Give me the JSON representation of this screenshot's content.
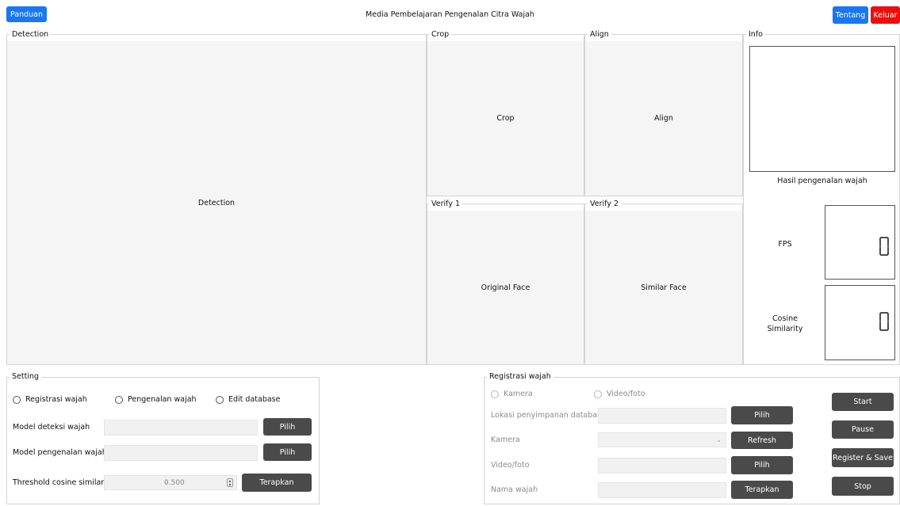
{
  "header": {
    "title": "Media Pembelajaran Pengenalan Citra Wajah",
    "guide_label": "Panduan",
    "about_label": "Tentang",
    "exit_label": "Keluar",
    "colors": {
      "primary": "#1877f2",
      "danger": "#ee0d0d"
    }
  },
  "detection": {
    "group_title": "Detection",
    "placeholder": "Detection"
  },
  "crop": {
    "group_title": "Crop",
    "placeholder": "Crop"
  },
  "align": {
    "group_title": "Align",
    "placeholder": "Align"
  },
  "verify1": {
    "group_title": "Verify 1",
    "placeholder": "Original Face"
  },
  "verify2": {
    "group_title": "Verify 2",
    "placeholder": "Similar Face"
  },
  "info": {
    "group_title": "Info",
    "result_label": "Hasil pengenalan wajah",
    "fps_label": "FPS",
    "fps_value": "0",
    "cosine_label_line1": "Cosine",
    "cosine_label_line2": "Similarity",
    "cosine_value": "0"
  },
  "setting": {
    "group_title": "Setting",
    "modes": [
      "Registrasi wajah",
      "Pengenalan wajah",
      "Edit database"
    ],
    "detection_model_label": "Model deteksi wajah",
    "recognition_model_label": "Model pengenalan wajah",
    "pick_label": "Pilih",
    "threshold_label": "Threshold cosine similarity",
    "threshold_value": "0.500",
    "apply_label": "Terapkan"
  },
  "registration": {
    "group_title": "Registrasi wajah",
    "sources": [
      "Kamera",
      "Video/foto"
    ],
    "db_location_label": "Lokasi penyimpanan database",
    "camera_label": "Kamera",
    "video_label": "Video/foto",
    "name_label": "Nama wajah",
    "pick_label": "Pilih",
    "refresh_label": "Refresh",
    "apply_label": "Terapkan"
  },
  "controls": {
    "start_label": "Start",
    "pause_label": "Pause",
    "register_save_label": "Register & Save",
    "stop_label": "Stop"
  }
}
